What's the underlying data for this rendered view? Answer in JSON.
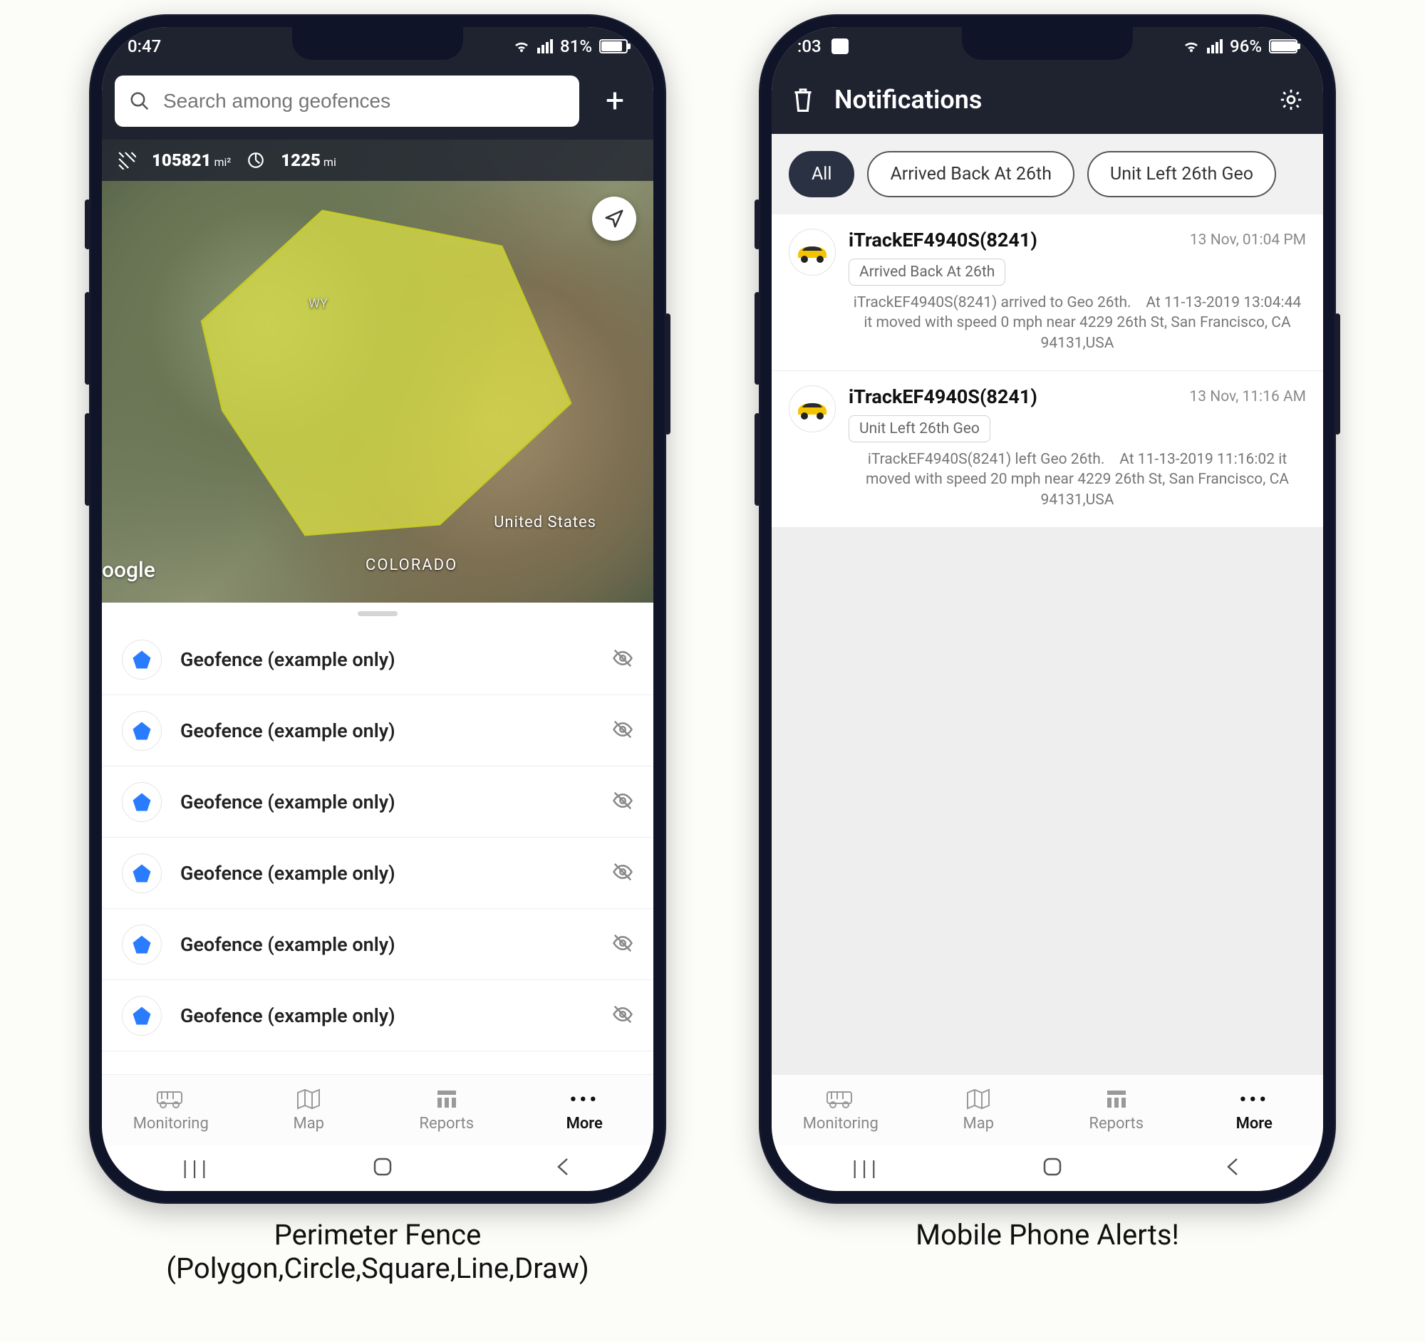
{
  "left": {
    "status": {
      "time": "0:47",
      "battery_pct": "81%",
      "battery_fill": "81%"
    },
    "search": {
      "placeholder": "Search among geofences"
    },
    "map": {
      "area_value": "105821",
      "area_unit": "mi²",
      "perimeter_value": "1225",
      "perimeter_unit": "mi",
      "labels": {
        "wy": "WY",
        "co": "COLORADO",
        "us": "United States"
      },
      "attribution": "oogle"
    },
    "geofences": [
      {
        "name": "Geofence (example only)"
      },
      {
        "name": "Geofence (example only)"
      },
      {
        "name": "Geofence (example only)"
      },
      {
        "name": "Geofence (example only)"
      },
      {
        "name": "Geofence (example only)"
      },
      {
        "name": "Geofence (example only)"
      }
    ],
    "tabs": {
      "monitoring": "Monitoring",
      "map": "Map",
      "reports": "Reports",
      "more": "More"
    },
    "caption_line1": "Perimeter Fence",
    "caption_line2": "(Polygon,Circle,Square,Line,Draw)"
  },
  "right": {
    "status": {
      "time": ":03",
      "battery_pct": "96%",
      "battery_fill": "96%"
    },
    "header": {
      "title": "Notifications"
    },
    "chips": {
      "all": "All",
      "arrived": "Arrived Back At 26th",
      "left": "Unit Left 26th Geo"
    },
    "notifications": [
      {
        "title": "iTrackEF4940S(8241)",
        "time": "13 Nov, 01:04 PM",
        "tag": "Arrived Back At 26th",
        "desc": "iTrackEF4940S(8241) arrived to Geo 26th.    At 11-13-2019 13:04:44 it moved with speed 0 mph near 4229 26th St, San Francisco, CA 94131,USA"
      },
      {
        "title": "iTrackEF4940S(8241)",
        "time": "13 Nov, 11:16 AM",
        "tag": "Unit Left 26th Geo",
        "desc": "iTrackEF4940S(8241) left Geo 26th.    At 11-13-2019 11:16:02 it moved with speed 20 mph near 4229 26th St, San Francisco, CA 94131,USA"
      }
    ],
    "tabs": {
      "monitoring": "Monitoring",
      "map": "Map",
      "reports": "Reports",
      "more": "More"
    },
    "caption": "Mobile Phone Alerts!"
  }
}
